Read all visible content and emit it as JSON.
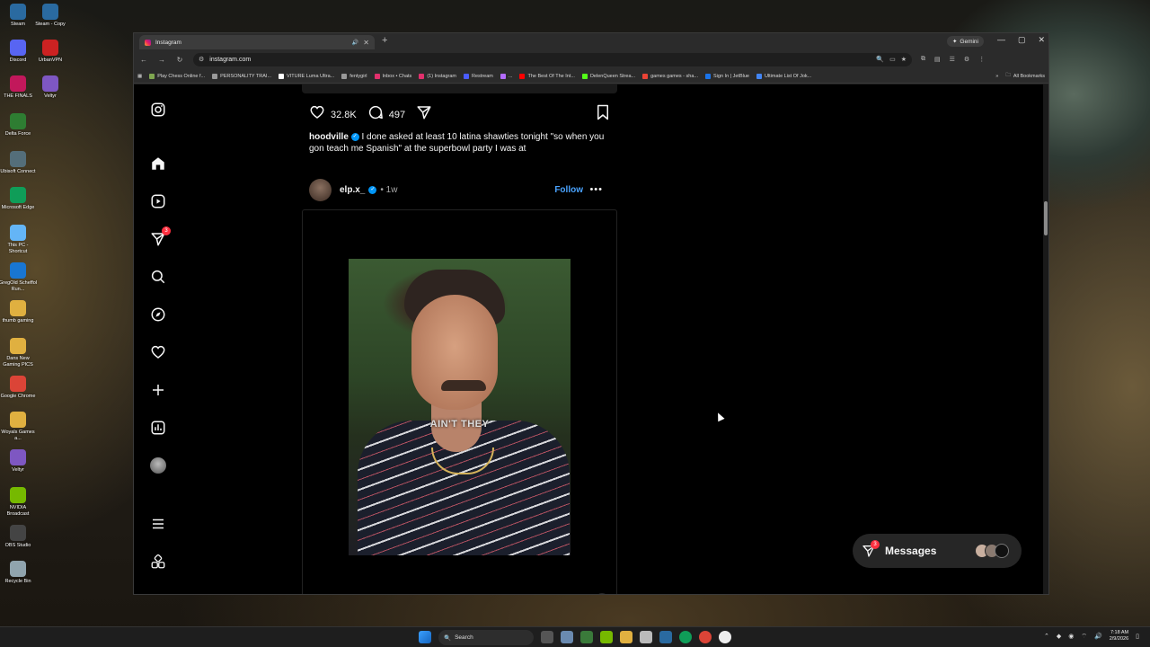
{
  "desktop_icons": [
    {
      "label": "Steam",
      "color": "#2a6aa0"
    },
    {
      "label": "Steam - Copy",
      "color": "#2a6aa0"
    },
    {
      "label": "Discord",
      "color": "#5865f2"
    },
    {
      "label": "UrbanVPN",
      "color": "#cc2222"
    },
    {
      "label": "THE FINALS",
      "color": "#c2185b"
    },
    {
      "label": "Veltyr",
      "color": "#7e57c2"
    },
    {
      "label": "Delta Force",
      "color": "#2e7d32"
    },
    {
      "label": "Ubisoft Connect",
      "color": "#546e7a"
    },
    {
      "label": "Microsoft Edge",
      "color": "#0f9d58"
    },
    {
      "label": "This PC - Shortcut",
      "color": "#64b5f6"
    },
    {
      "label": "GregOld Scheffol Run...",
      "color": "#1976d2"
    },
    {
      "label": "thumb gaming",
      "color": "#e0b040"
    },
    {
      "label": "Dans New Gaming PICS",
      "color": "#e0b040"
    },
    {
      "label": "Google Chrome",
      "color": "#db4437"
    },
    {
      "label": "Woyals Games a...",
      "color": "#e0b040"
    },
    {
      "label": "Veltyr",
      "color": "#7e57c2"
    },
    {
      "label": "NVIDIA Broadcast",
      "color": "#76b900"
    },
    {
      "label": "OBS Studio",
      "color": "#444444"
    },
    {
      "label": "Recycle Bin",
      "color": "#90a4ae"
    }
  ],
  "browser": {
    "tab_title": "Instagram",
    "new_tab": "+",
    "gemini_label": "Gemini",
    "url": "instagram.com",
    "bookmarks": [
      {
        "label": "Play Chess Online f...",
        "color": "#7fa650"
      },
      {
        "label": "PERSONALITY TRAI...",
        "color": "#999999"
      },
      {
        "label": "VITURE Luma Ultra...",
        "color": "#ffffff"
      },
      {
        "label": "fentygirl",
        "color": "#999999"
      },
      {
        "label": "Inbox • Chats",
        "color": "#e1306c"
      },
      {
        "label": "(1) Instagram",
        "color": "#e1306c"
      },
      {
        "label": "Restream",
        "color": "#4a5cff"
      },
      {
        "label": "...",
        "color": "#b36bff"
      },
      {
        "label": "The Best Of The Int...",
        "color": "#ff0000"
      },
      {
        "label": "DelenQueen Strea...",
        "color": "#53fc18"
      },
      {
        "label": "games games - sha...",
        "color": "#ea4335"
      },
      {
        "label": "Sign In | JetBlue",
        "color": "#1a73e8"
      },
      {
        "label": "Ultimate List Of Jok...",
        "color": "#4285f4"
      }
    ],
    "all_bookmarks": "All Bookmarks"
  },
  "instagram": {
    "nav_badge": "3",
    "prev_post": {
      "likes": "32.8K",
      "comments": "497",
      "caption_user": "hoodville",
      "caption_text": "I done asked at least 10 latina shawties tonight \"so when you gon teach me Spanish\" at the superbowl party I was at"
    },
    "post": {
      "username": "elp.x_",
      "time": "• 1w",
      "follow_label": "Follow",
      "more": "•••",
      "subtitle": "AIN'T THEY"
    },
    "messages": {
      "label": "Messages",
      "badge": "3"
    }
  },
  "taskbar": {
    "search_label": "Search",
    "time": "7:18 AM",
    "date": "2/9/2026"
  }
}
